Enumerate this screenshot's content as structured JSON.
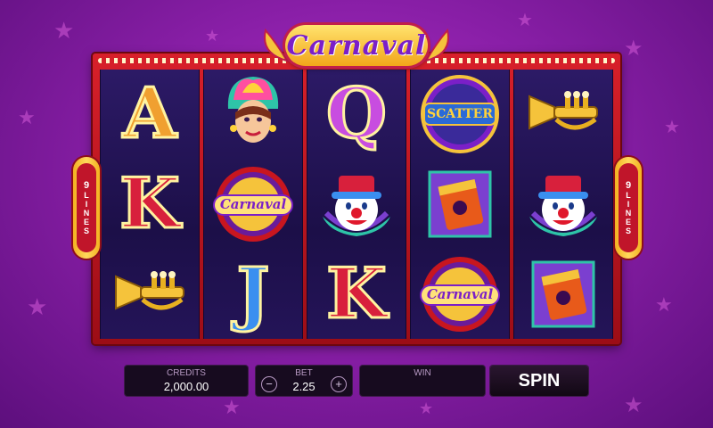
{
  "game": {
    "title": "Carnaval",
    "lines_label_left": "9",
    "lines_word_left": "LINES",
    "lines_label_right": "9",
    "lines_word_right": "LINES"
  },
  "reels": [
    [
      "letter-a",
      "letter-k",
      "trumpet"
    ],
    [
      "carnival-dancer",
      "carnaval-logo",
      "letter-j"
    ],
    [
      "letter-q",
      "clown",
      "letter-k"
    ],
    [
      "scatter",
      "drum",
      "carnaval-logo"
    ],
    [
      "trumpet",
      "clown",
      "drum"
    ]
  ],
  "symbols": {
    "letter_a": "A",
    "letter_k": "K",
    "letter_j": "J",
    "letter_q": "Q",
    "scatter": "SCATTER",
    "logo_text": "Carnaval"
  },
  "controls": {
    "credits_label": "CREDITS",
    "credits_value": "2,000.00",
    "bet_label": "BET",
    "bet_value": "2.25",
    "bet_minus": "−",
    "bet_plus": "+",
    "win_label": "WIN",
    "win_value": "",
    "spin_label": "SPIN"
  },
  "colors": {
    "background": "#9a25b6",
    "frame": "#c8161f",
    "reel_bg": "#22145a",
    "gold": "#f5c33b"
  }
}
